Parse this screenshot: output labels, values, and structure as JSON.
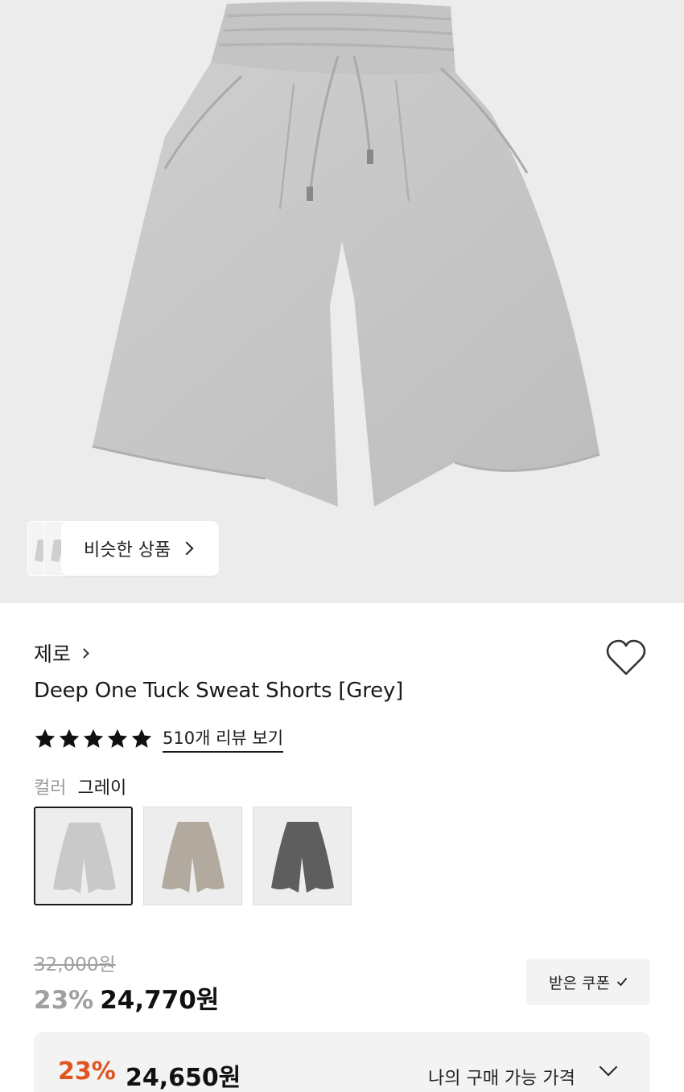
{
  "product": {
    "brand": "제로",
    "title": "Deep One Tuck Sweat Shorts [Grey]",
    "review_link": "510개 리뷰 보기",
    "rating_stars": 5,
    "color_label": "컬러",
    "color_value": "그레이",
    "swatches": [
      {
        "name": "grey",
        "color": "#c9c9c9"
      },
      {
        "name": "beige",
        "color": "#b3aa9f"
      },
      {
        "name": "charcoal",
        "color": "#5e5e5e"
      }
    ]
  },
  "hero": {
    "similar_label": "비슷한 상품",
    "main_color": "#c8c8c8"
  },
  "pricing": {
    "original": "32,000원",
    "discount": "23%",
    "sale": "24,770원",
    "coupon_label": "받은 쿠폰",
    "my_discount": "23%",
    "my_price": "24,650원",
    "my_price_label": "나의 구매 가능 가격",
    "accent_color": "#e0541f"
  }
}
